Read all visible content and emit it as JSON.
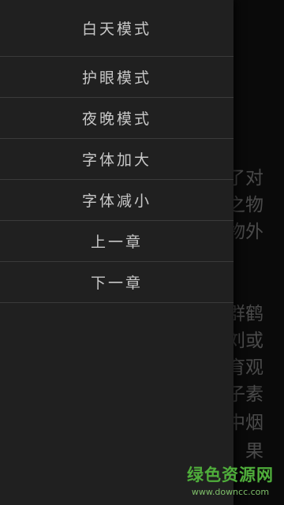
{
  "menu": {
    "items": [
      {
        "label": "白天模式"
      },
      {
        "label": "护眼模式"
      },
      {
        "label": "夜晚模式"
      },
      {
        "label": "字体加大"
      },
      {
        "label": "字体减小"
      },
      {
        "label": "上一章"
      },
      {
        "label": "下一章"
      }
    ]
  },
  "reader": {
    "lines": [
      "了对",
      "之物",
      "物外",
      "群鹤",
      "刘或",
      "育观",
      "子素",
      "中烟",
      "果"
    ]
  },
  "watermark": {
    "title": "绿色资源网",
    "url": "www.downcc.com"
  }
}
